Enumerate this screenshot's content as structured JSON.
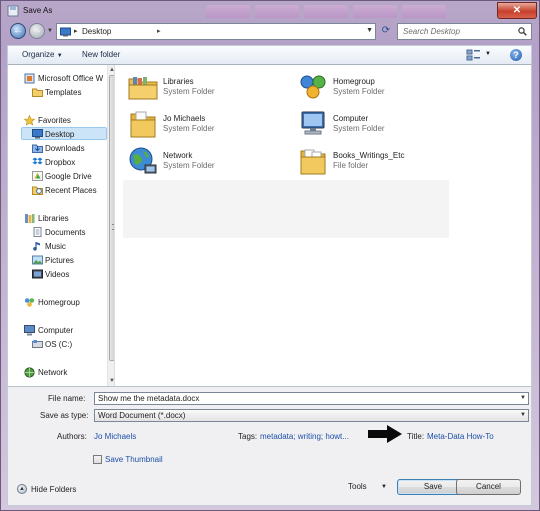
{
  "window": {
    "title": "Save As"
  },
  "address": {
    "location": "Desktop"
  },
  "search": {
    "placeholder": "Search Desktop"
  },
  "toolbar": {
    "organize_label": "Organize",
    "new_folder_label": "New folder"
  },
  "sidebar": {
    "items": [
      {
        "label": "Microsoft Office W",
        "icon": "office-icon"
      },
      {
        "label": "Templates",
        "icon": "folder-icon"
      },
      {
        "label": "Favorites",
        "icon": "star-icon"
      },
      {
        "label": "Desktop",
        "icon": "desktop-icon",
        "selected": true
      },
      {
        "label": "Downloads",
        "icon": "downloads-icon"
      },
      {
        "label": "Dropbox",
        "icon": "dropbox-icon"
      },
      {
        "label": "Google Drive",
        "icon": "google-drive-icon"
      },
      {
        "label": "Recent Places",
        "icon": "recent-places-icon"
      },
      {
        "label": "Libraries",
        "icon": "libraries-icon"
      },
      {
        "label": "Documents",
        "icon": "documents-icon"
      },
      {
        "label": "Music",
        "icon": "music-icon"
      },
      {
        "label": "Pictures",
        "icon": "pictures-icon"
      },
      {
        "label": "Videos",
        "icon": "videos-icon"
      },
      {
        "label": "Homegroup",
        "icon": "homegroup-icon"
      },
      {
        "label": "Computer",
        "icon": "computer-icon"
      },
      {
        "label": "OS (C:)",
        "icon": "drive-icon"
      },
      {
        "label": "Network",
        "icon": "network-icon"
      }
    ]
  },
  "files": [
    {
      "name": "Libraries",
      "type": "System Folder",
      "icon": "libraries-folder-icon"
    },
    {
      "name": "Homegroup",
      "type": "System Folder",
      "icon": "homegroup-icon"
    },
    {
      "name": "Jo Michaels",
      "type": "System Folder",
      "icon": "user-folder-icon"
    },
    {
      "name": "Computer",
      "type": "System Folder",
      "icon": "computer-icon"
    },
    {
      "name": "Network",
      "type": "System Folder",
      "icon": "network-globe-icon"
    },
    {
      "name": "Books_Writings_Etc",
      "type": "File folder",
      "icon": "folder-icon"
    }
  ],
  "form": {
    "file_name_label": "File name:",
    "file_name_value": "Show me the metadata.docx",
    "save_type_label": "Save as type:",
    "save_type_value": "Word Document (*.docx)",
    "authors_label": "Authors:",
    "authors_value": "Jo Michaels",
    "tags_label": "Tags:",
    "tags_value": "metadata; writing; howt...",
    "title_label": "Title:",
    "title_value": "Meta-Data How-To",
    "thumbnail_label": "Save Thumbnail"
  },
  "footer": {
    "hide_folders_label": "Hide Folders",
    "tools_label": "Tools",
    "save_label": "Save",
    "cancel_label": "Cancel"
  },
  "colors": {
    "selection": "#cce4f7",
    "link": "#1d4fa6",
    "frame": "#b3a1c7"
  }
}
